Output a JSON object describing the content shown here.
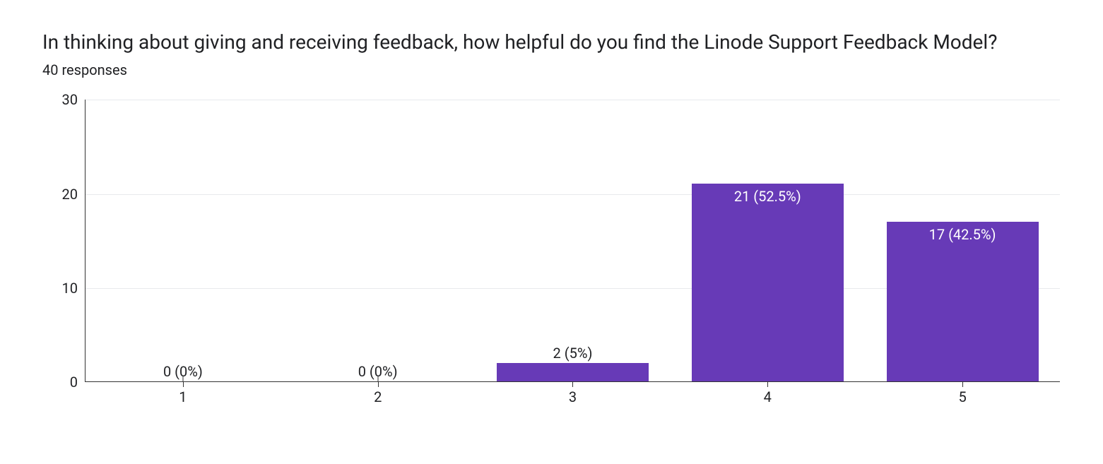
{
  "title": "In thinking about giving and receiving feedback, how helpful do you find the Linode Support Feedback Model?",
  "subtitle": "40 responses",
  "chart_data": {
    "type": "bar",
    "categories": [
      "1",
      "2",
      "3",
      "4",
      "5"
    ],
    "values": [
      0,
      0,
      2,
      21,
      17
    ],
    "percents": [
      "0%",
      "0%",
      "5%",
      "52.5%",
      "42.5%"
    ],
    "labels": [
      "0 (0%)",
      "0 (0%)",
      "2 (5%)",
      "21 (52.5%)",
      "17 (42.5%)"
    ],
    "label_inside": [
      false,
      false,
      false,
      true,
      true
    ],
    "yticks": [
      0,
      10,
      20,
      30
    ],
    "ylim": [
      0,
      30
    ],
    "bar_color": "#673ab7",
    "title": "In thinking about giving and receiving feedback, how helpful do you find the Linode Support Feedback Model?",
    "xlabel": "",
    "ylabel": ""
  }
}
